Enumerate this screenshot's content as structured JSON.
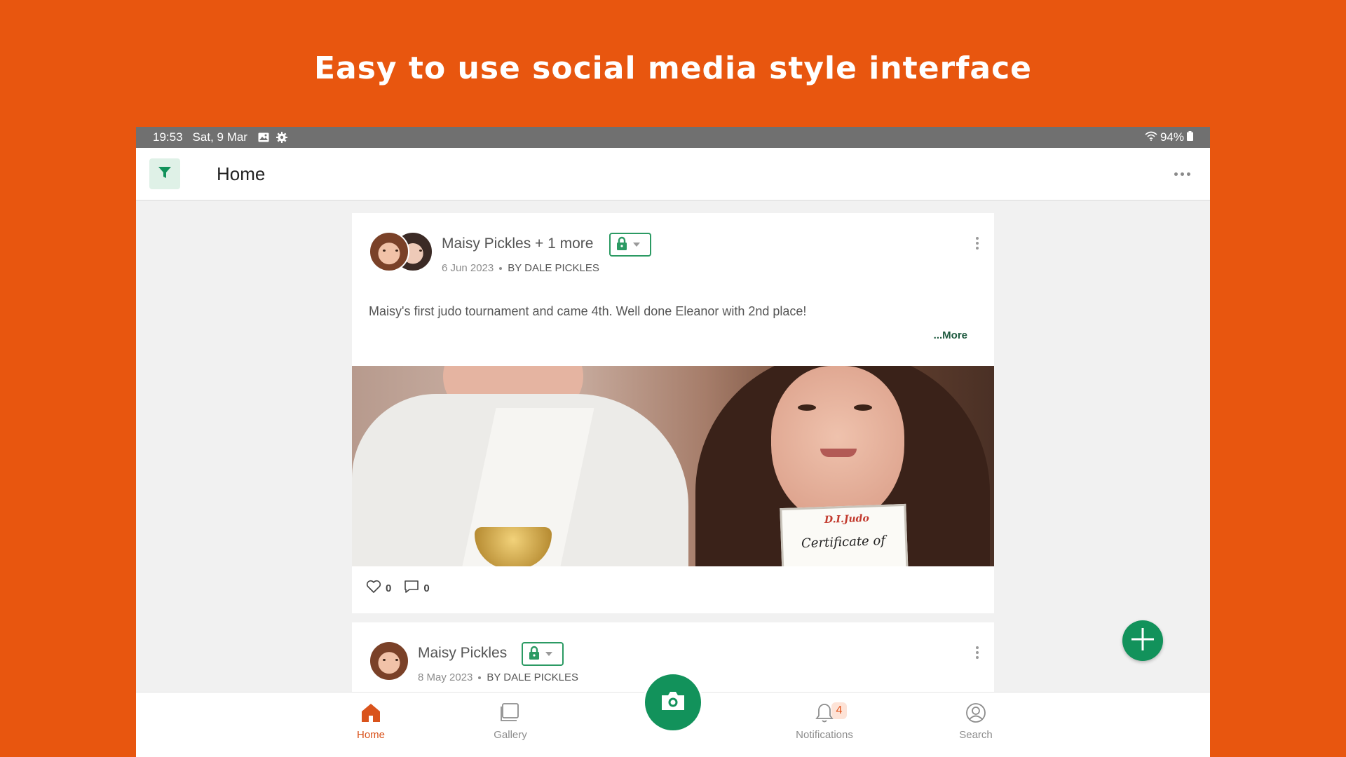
{
  "headline": "Easy to use social media style interface",
  "status_bar": {
    "time": "19:53",
    "date": "Sat, 9 Mar",
    "left_icons": [
      "image-icon",
      "gear-icon"
    ],
    "right_icons": [
      "wifi-icon",
      "battery-icon"
    ],
    "battery": "94%"
  },
  "app_bar": {
    "title": "Home",
    "filter_icon": "filter-icon",
    "more_icon": "more-horizontal-icon"
  },
  "posts": [
    {
      "name": "Maisy Pickles + 1 more",
      "date": "6 Jun 2023",
      "by": "BY DALE PICKLES",
      "privacy_icon": "lock-icon",
      "text": "Maisy's first judo tournament and came 4th. Well done Eleanor with 2nd place!",
      "more_label": "...More",
      "likes": "0",
      "comments": "0"
    },
    {
      "name": "Maisy Pickles",
      "date": "8 May 2023",
      "by": "BY DALE PICKLES",
      "privacy_icon": "lock-icon"
    }
  ],
  "bottom_nav": {
    "home": "Home",
    "gallery": "Gallery",
    "notifications": "Notifications",
    "notifications_badge": "4",
    "search": "Search"
  },
  "colors": {
    "background": "#e8560f",
    "primary_green": "#12925b",
    "active_nav": "#d9531c"
  }
}
